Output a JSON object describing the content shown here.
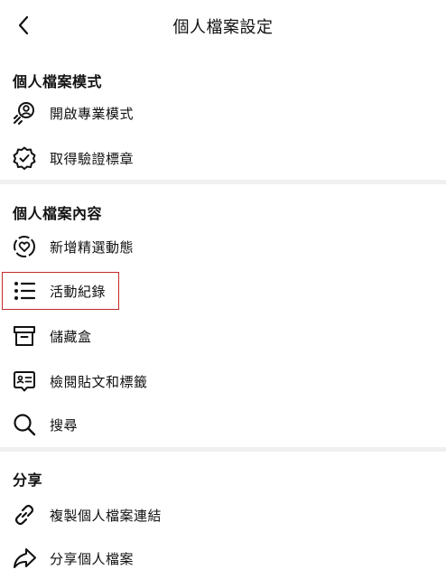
{
  "header": {
    "title": "個人檔案設定",
    "back_icon": "chevron-left-icon"
  },
  "sections": [
    {
      "title": "個人檔案模式",
      "items": [
        {
          "label": "開啟專業模式",
          "icon": "professional-mode-icon"
        },
        {
          "label": "取得驗證標章",
          "icon": "verified-badge-icon"
        }
      ]
    },
    {
      "title": "個人檔案內容",
      "items": [
        {
          "label": "新增精選動態",
          "icon": "highlight-heart-icon"
        },
        {
          "label": "活動紀錄",
          "icon": "list-icon",
          "highlighted": true
        },
        {
          "label": "儲藏盒",
          "icon": "archive-icon"
        },
        {
          "label": "檢閱貼文和標籤",
          "icon": "review-tags-icon"
        },
        {
          "label": "搜尋",
          "icon": "search-icon"
        }
      ]
    },
    {
      "title": "分享",
      "items": [
        {
          "label": "複製個人檔案連結",
          "icon": "link-icon"
        },
        {
          "label": "分享個人檔案",
          "icon": "share-icon"
        }
      ]
    }
  ],
  "colors": {
    "highlight_border": "#c62828",
    "divider": "#f0f0f0",
    "text": "#111111"
  }
}
